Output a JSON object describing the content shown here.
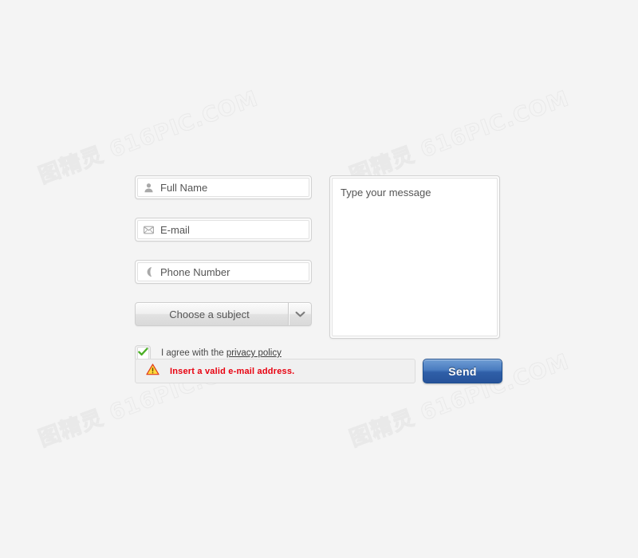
{
  "watermark": {
    "text": "图精灵 616PIC.COM"
  },
  "form": {
    "fields": [
      {
        "icon": "user-icon",
        "placeholder": "Full Name",
        "value": ""
      },
      {
        "icon": "email-icon",
        "placeholder": "E-mail",
        "value": ""
      },
      {
        "icon": "phone-icon",
        "placeholder": "Phone Number",
        "value": ""
      }
    ],
    "subject_select": {
      "selected": "Choose a subject",
      "arrow_icon": "chevron-down-icon"
    },
    "agreement": {
      "checked": true,
      "check_icon": "check-icon",
      "text_before": "I agree with the ",
      "link_label": "privacy policy"
    },
    "message": {
      "placeholder": "Type your message",
      "value": ""
    },
    "error": {
      "icon": "warning-triangle-icon",
      "message": "Insert a valid e-mail address."
    },
    "submit": {
      "label": "Send"
    }
  },
  "colors": {
    "background": "#f4f4f4",
    "error_text": "#e8000f",
    "warning_icon": "#ffcc00",
    "check_green": "#4caf27",
    "button_blue": "#2f5fa8"
  }
}
